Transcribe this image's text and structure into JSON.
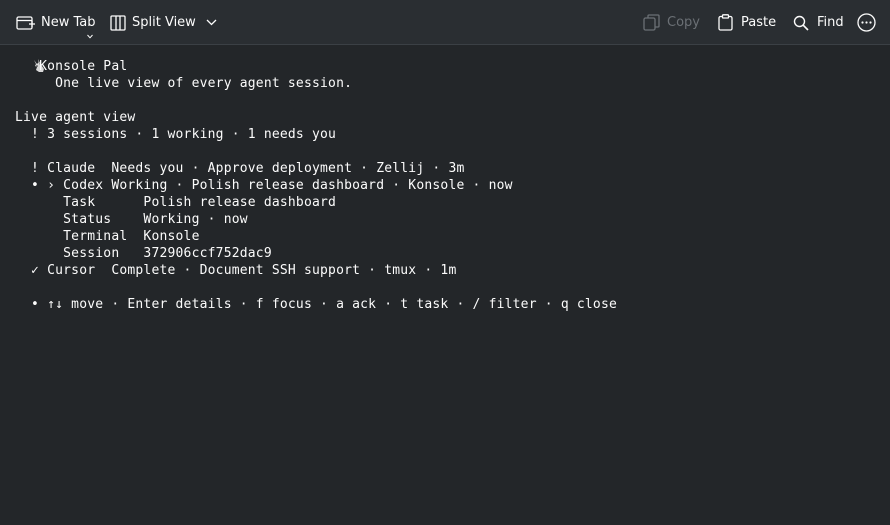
{
  "toolbar": {
    "new_tab": "New Tab",
    "split_view": "Split View",
    "copy": "Copy",
    "paste": "Paste",
    "find": "Find"
  },
  "terminal": {
    "lines": [
      "   Konsole Pal",
      "     One live view of every agent session.",
      "",
      "Live agent view",
      "  ! 3 sessions · 1 working · 1 needs you",
      "",
      "  ! Claude  Needs you · Approve deployment · Zellij · 3m",
      "  • › Codex Working · Polish release dashboard · Konsole · now",
      "      Task      Polish release dashboard",
      "      Status    Working · now",
      "      Terminal  Konsole",
      "      Session   372906ccf752dac9",
      "  ✓ Cursor  Complete · Document SSH support · tmux · 1m",
      "",
      "  • ↑↓ move · Enter details · f focus · a ack · t task · / filter · q close"
    ]
  },
  "colors": {
    "background": "#232629",
    "toolbar": "#2a2e32",
    "text": "#fcfcfc",
    "disabled": "#6b7075"
  }
}
